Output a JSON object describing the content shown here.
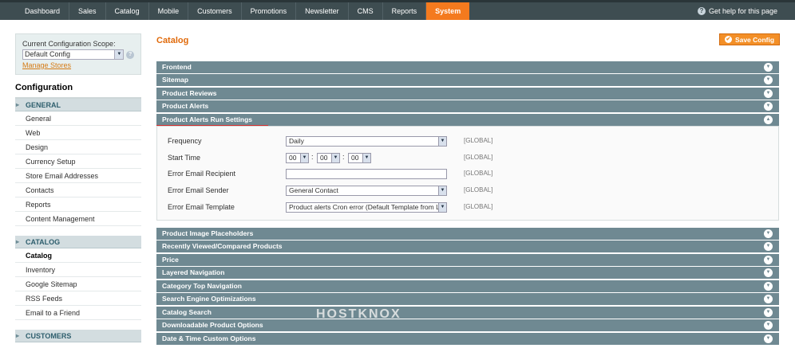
{
  "nav": {
    "tabs": [
      "Dashboard",
      "Sales",
      "Catalog",
      "Mobile",
      "Customers",
      "Promotions",
      "Newsletter",
      "CMS",
      "Reports",
      "System"
    ],
    "active_tab": "System",
    "help_text": "Get help for this page"
  },
  "scope": {
    "label": "Current Configuration Scope:",
    "selected": "Default Config",
    "manage_link": "Manage Stores"
  },
  "sidebar": {
    "title": "Configuration",
    "sections": [
      {
        "name": "GENERAL",
        "items": [
          "General",
          "Web",
          "Design",
          "Currency Setup",
          "Store Email Addresses",
          "Contacts",
          "Reports",
          "Content Management"
        ]
      },
      {
        "name": "CATALOG",
        "items": [
          "Catalog",
          "Inventory",
          "Google Sitemap",
          "RSS Feeds",
          "Email to a Friend"
        ]
      },
      {
        "name": "CUSTOMERS",
        "items": []
      }
    ],
    "active_item": "Catalog"
  },
  "main": {
    "title": "Catalog",
    "save_label": "Save Config",
    "groups_top": [
      "Frontend",
      "Sitemap",
      "Product Reviews",
      "Product Alerts"
    ],
    "expanded_group": "Product Alerts Run Settings",
    "fields": [
      {
        "label": "Frequency",
        "value": "Daily",
        "scope": "[GLOBAL]"
      },
      {
        "label": "Start Time",
        "hour": "00",
        "minute": "00",
        "second": "00",
        "scope": "[GLOBAL]"
      },
      {
        "label": "Error Email Recipient",
        "value": "",
        "scope": "[GLOBAL]"
      },
      {
        "label": "Error Email Sender",
        "value": "General Contact",
        "scope": "[GLOBAL]"
      },
      {
        "label": "Error Email Template",
        "value": "Product alerts Cron error (Default Template from Locale)",
        "scope": "[GLOBAL]"
      }
    ],
    "groups_bottom": [
      "Product Image Placeholders",
      "Recently Viewed/Compared Products",
      "Price",
      "Layered Navigation",
      "Category Top Navigation",
      "Search Engine Optimizations",
      "Catalog Search",
      "Downloadable Product Options",
      "Date & Time Custom Options"
    ]
  },
  "watermark": "HOSTKNOX"
}
